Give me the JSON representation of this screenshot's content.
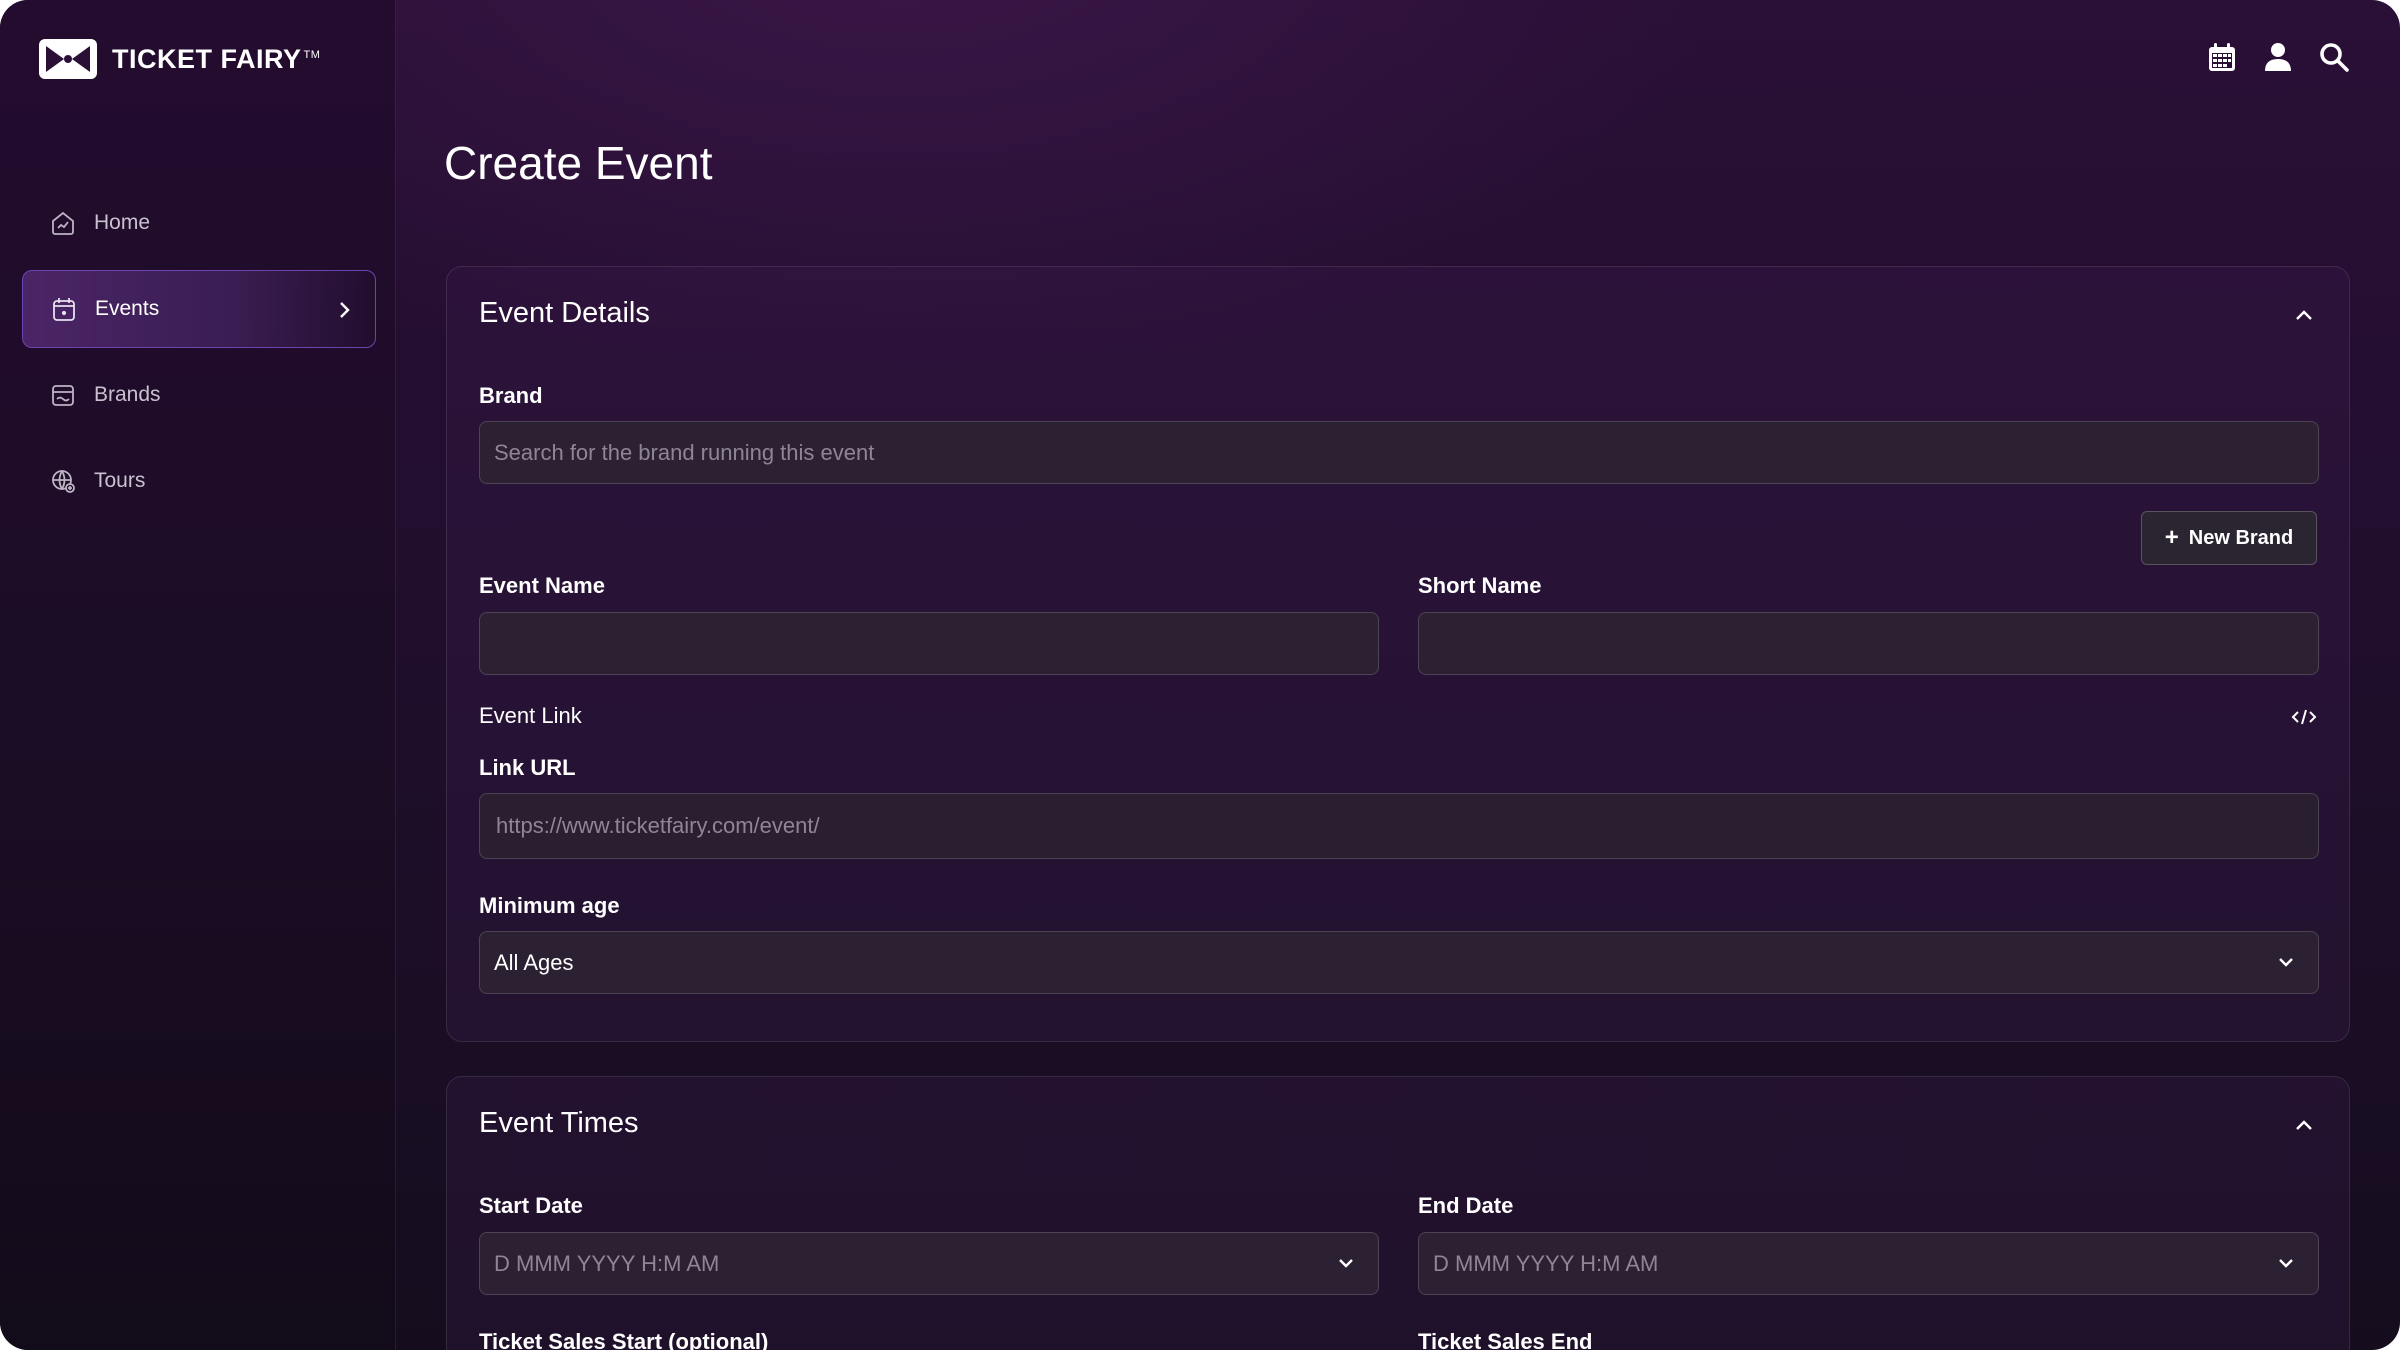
{
  "app": {
    "brand_name": "TICKET FAIRY",
    "brand_tm": "TM"
  },
  "sidebar": {
    "items": [
      {
        "label": "Home",
        "icon": "home-icon",
        "active": false
      },
      {
        "label": "Events",
        "icon": "calendar-icon",
        "active": true
      },
      {
        "label": "Brands",
        "icon": "store-icon",
        "active": false
      },
      {
        "label": "Tours",
        "icon": "globe-icon",
        "active": false
      }
    ]
  },
  "header": {
    "icons": [
      "calendar-icon",
      "user-icon",
      "search-icon"
    ]
  },
  "page": {
    "title": "Create Event"
  },
  "event_details": {
    "title": "Event Details",
    "brand_label": "Brand",
    "brand_placeholder": "Search for the brand running this event",
    "new_brand_label": "New Brand",
    "event_name_label": "Event Name",
    "event_name_value": "",
    "short_name_label": "Short Name",
    "short_name_value": "",
    "event_link_label": "Event Link",
    "link_url_label": "Link URL",
    "link_url_placeholder": "https://www.ticketfairy.com/event/",
    "minimum_age_label": "Minimum age",
    "minimum_age_value": "All Ages"
  },
  "event_times": {
    "title": "Event Times",
    "start_date_label": "Start Date",
    "start_date_placeholder": "D MMM YYYY H:M AM",
    "end_date_label": "End Date",
    "end_date_placeholder": "D MMM YYYY H:M AM",
    "ticket_sales_start_label": "Ticket Sales Start (optional)",
    "ticket_sales_end_label": "Ticket Sales End"
  },
  "colors": {
    "accent_border": "#6a45b0",
    "background": "#1e0e2a"
  }
}
